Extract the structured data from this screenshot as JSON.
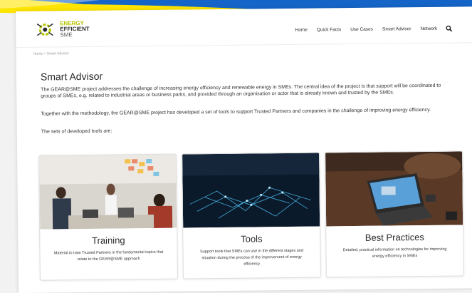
{
  "header": {
    "logo": {
      "line1": "ENERGY",
      "line2": "EFFICIENT",
      "line3": "SME"
    },
    "nav": [
      {
        "label": "Home"
      },
      {
        "label": "Quick Facts"
      },
      {
        "label": "Use Cases"
      },
      {
        "label": "Smart Advisor"
      },
      {
        "label": "Network"
      }
    ],
    "search_icon": "search-icon"
  },
  "breadcrumb": "Home > Smart Advisor",
  "page": {
    "title": "Smart Advisor",
    "paragraphs": [
      "The GEAR@SME project addresses the challenge of increasing energy efficiency and renewable energy in SMEs. The central idea of the project is that support will be coordinated to groups of SMEs, e.g. related to industrial areas or business parks, and provided through an organisation or actor that is already known and trusted by the SMEs.",
      "Together with the methodology, the GEAR@SME project has developed a set of tools to support Trusted Partners and companies in the challenge of improving energy efficiency.",
      "The sets of developed tools are:"
    ]
  },
  "cards": [
    {
      "title": "Training",
      "description": "Material to train Trusted Partners in the fundamental topics that relate to the GEAR@SME approach"
    },
    {
      "title": "Tools",
      "description": "Support tools that SMEs can use in the different stages and situation during the process of the improvement of energy efficiency"
    },
    {
      "title": "Best Practices",
      "description": "Detailed, practical information on technologies for improving energy efficiency in SMEs"
    }
  ],
  "colors": {
    "accent_blue": "#1565c8",
    "accent_yellow": "#ffe500",
    "logo_green": "#b5c400"
  }
}
